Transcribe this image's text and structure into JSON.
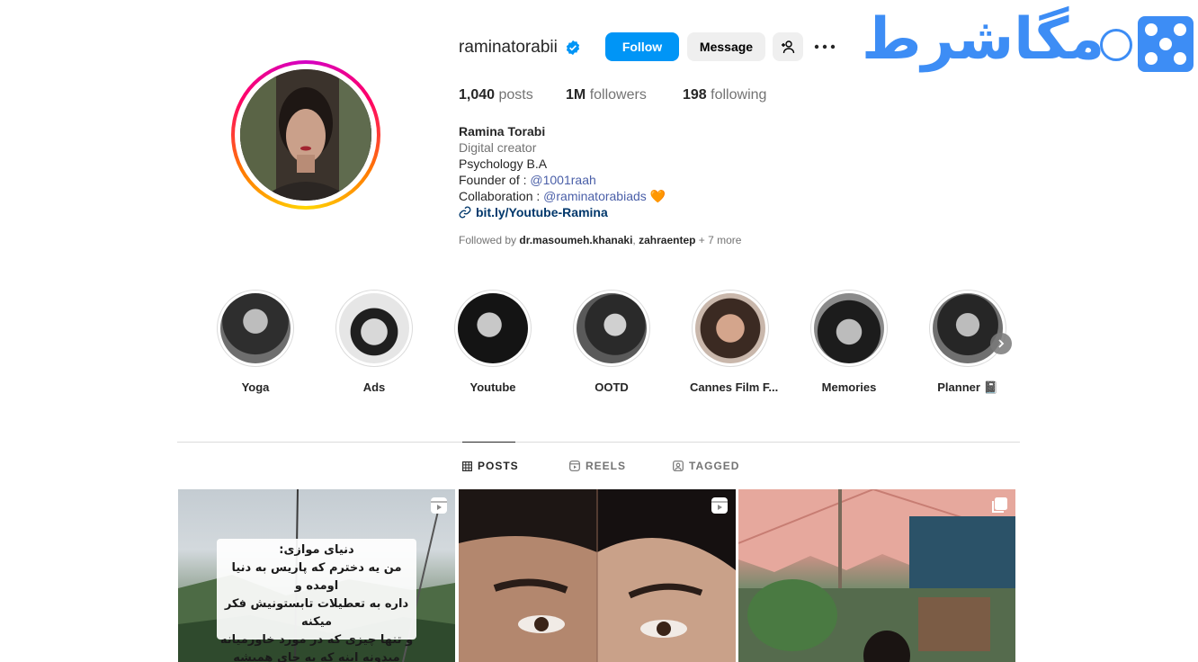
{
  "watermark": {
    "text": "مگاشرط"
  },
  "profile": {
    "username": "raminatorabii",
    "actions": {
      "follow": "Follow",
      "message": "Message"
    },
    "stats": [
      {
        "value": "1,040",
        "label": "posts"
      },
      {
        "value": "1M",
        "label": "followers"
      },
      {
        "value": "198",
        "label": "following"
      }
    ],
    "bio": {
      "name": "Ramina Torabi",
      "category": "Digital creator",
      "line1": "Psychology B.A",
      "founder_prefix": "Founder of : ",
      "founder_mention": "@1001raah",
      "collab_prefix": "Collaboration : ",
      "collab_mention": "@raminatorabiads",
      "collab_emoji": "🧡",
      "link": "bit.ly/Youtube-Ramina"
    },
    "followed_by": {
      "prefix": "Followed by ",
      "user1": "dr.masoumeh.khanaki",
      "sep": ", ",
      "user2": "zahraentep",
      "more": " + 7 more"
    }
  },
  "highlights": [
    {
      "label": "Yoga"
    },
    {
      "label": "Ads"
    },
    {
      "label": "Youtube"
    },
    {
      "label": "OOTD"
    },
    {
      "label": "Cannes Film F..."
    },
    {
      "label": "Memories"
    },
    {
      "label": "Planner 📓"
    }
  ],
  "tabs": [
    {
      "label": "POSTS",
      "icon": "grid-icon"
    },
    {
      "label": "REELS",
      "icon": "reels-icon"
    },
    {
      "label": "TAGGED",
      "icon": "tagged-icon"
    }
  ],
  "posts": {
    "p1_caption": [
      "دنیای موازی:",
      "من یه دخترم که پاریس به دنیا اومده و",
      "داره به تعطیلات تابستونیش فکر میکنه",
      "و تنها چیزی که در مورد خاورمیانه",
      "میدونه اینه که یه جای همیشه ملتهبه"
    ]
  },
  "colors": {
    "accent": "#0095f6",
    "watermark": "#3d8df5",
    "mention": "#4a5fa8",
    "link": "#00376b"
  }
}
